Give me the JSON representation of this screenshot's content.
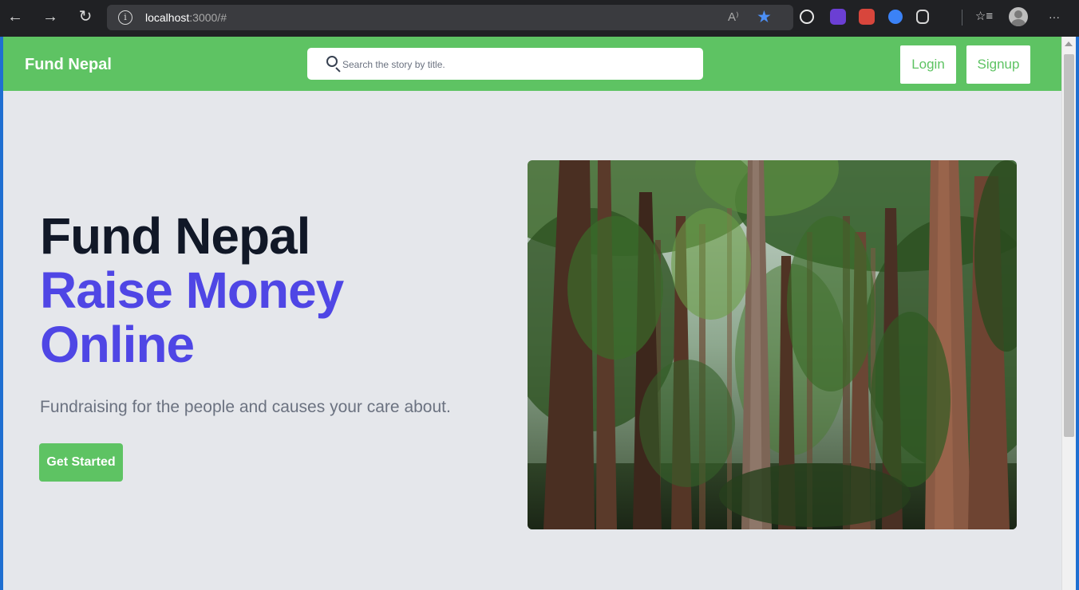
{
  "browser": {
    "url_host": "localhost",
    "url_path": ":3000/#",
    "icons": [
      "back-icon",
      "forward-icon",
      "refresh-icon",
      "info-icon",
      "read-aloud-icon",
      "favorite-star-icon",
      "extension-icons",
      "favorites-icon",
      "profile-icon",
      "more-icon"
    ],
    "back_glyph": "←",
    "forward_glyph": "→",
    "refresh_glyph": "↻",
    "info_glyph": "i",
    "read_glyph": "A⁾",
    "star_glyph": "★",
    "favorites_glyph": "☆≡",
    "more_glyph": "···"
  },
  "navbar": {
    "brand": "Fund Nepal",
    "search_placeholder": "Search the story by title.",
    "login_label": "Login",
    "signup_label": "Signup",
    "bg_color": "#5ec363"
  },
  "hero": {
    "title_line1": "Fund Nepal",
    "title_line2": "Raise Money",
    "title_line3": "Online",
    "subtitle": "Fundraising for the people and causes your care about.",
    "cta_label": "Get Started",
    "accent_color": "#4f46e5"
  }
}
